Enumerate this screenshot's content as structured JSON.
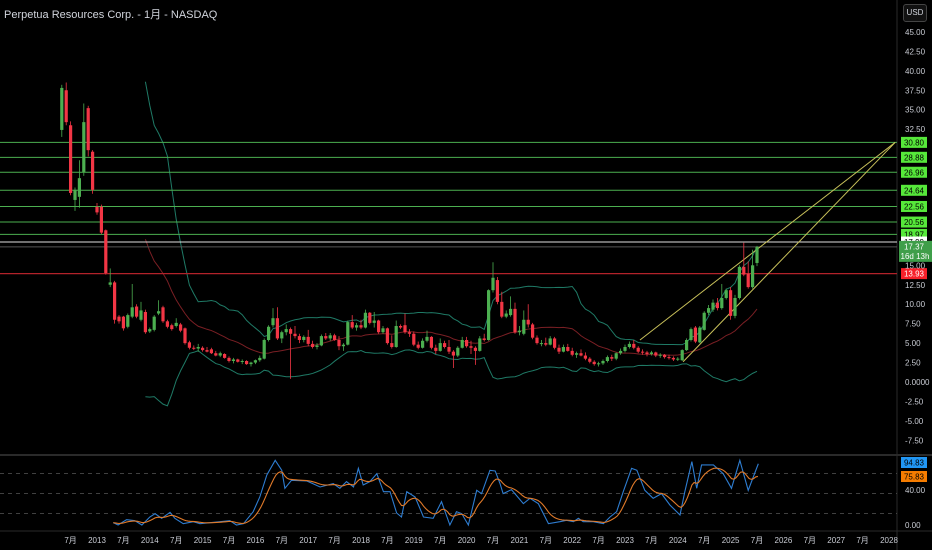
{
  "header": {
    "title": "Perpetua Resources Corp. - 1月 - NASDAQ",
    "currency_button": "USD"
  },
  "price_axis": {
    "ticks": [
      "45.00",
      "42.50",
      "40.00",
      "37.50",
      "35.00",
      "32.50",
      "15.00",
      "12.50",
      "10.00",
      "7.50",
      "5.00",
      "2.50",
      "0.0000",
      "-2.50",
      "-5.00",
      "-7.50"
    ],
    "tick_values": [
      45,
      42.5,
      40,
      37.5,
      35,
      32.5,
      15,
      12.5,
      10,
      7.5,
      5,
      2.5,
      0,
      -2.5,
      -5,
      -7.5
    ]
  },
  "levels": [
    {
      "value": 30.8,
      "label": "30.80",
      "kind": "green"
    },
    {
      "value": 28.88,
      "label": "28.88",
      "kind": "green"
    },
    {
      "value": 26.96,
      "label": "26.96",
      "kind": "green"
    },
    {
      "value": 24.64,
      "label": "24.64",
      "kind": "green"
    },
    {
      "value": 22.56,
      "label": "22.56",
      "kind": "green"
    },
    {
      "value": 20.56,
      "label": "20.56",
      "kind": "green"
    },
    {
      "value": 18.97,
      "label": "18.97",
      "kind": "green"
    },
    {
      "value": 17.99,
      "label": "17.99",
      "kind": "white"
    },
    {
      "value": 13.93,
      "label": "13.93",
      "kind": "red"
    }
  ],
  "current_price": {
    "value": 17.37,
    "label": "17.37",
    "countdown": "16d 13h"
  },
  "colors": {
    "up": "#4caf50",
    "down": "#f23645",
    "level_green": "#4caf50",
    "level_tag": "#56e83a",
    "red_level": "#b2222a",
    "red_tag": "#f7202a",
    "band": "#1f7a66",
    "basis": "#7a1f24",
    "trend": "#c8c05a",
    "rsi_k": "#2e7dd1",
    "rsi_d": "#e07a2a"
  },
  "rsi": {
    "k_label": "94.83",
    "d_label": "75.83",
    "ticks": [
      "40.00",
      "0.00"
    ],
    "tick_values": [
      40,
      0
    ],
    "bands": [
      80,
      50,
      20
    ]
  },
  "time_axis": [
    {
      "label": "7月",
      "m": -6
    },
    {
      "label": "2013",
      "m": 0
    },
    {
      "label": "7月",
      "m": 6
    },
    {
      "label": "2014",
      "m": 12
    },
    {
      "label": "7月",
      "m": 18
    },
    {
      "label": "2015",
      "m": 24
    },
    {
      "label": "7月",
      "m": 30
    },
    {
      "label": "2016",
      "m": 36
    },
    {
      "label": "7月",
      "m": 42
    },
    {
      "label": "2017",
      "m": 48
    },
    {
      "label": "7月",
      "m": 54
    },
    {
      "label": "2018",
      "m": 60
    },
    {
      "label": "7月",
      "m": 66
    },
    {
      "label": "2019",
      "m": 72
    },
    {
      "label": "7月",
      "m": 78
    },
    {
      "label": "2020",
      "m": 84
    },
    {
      "label": "7月",
      "m": 90
    },
    {
      "label": "2021",
      "m": 96
    },
    {
      "label": "7月",
      "m": 102
    },
    {
      "label": "2022",
      "m": 108
    },
    {
      "label": "7月",
      "m": 114
    },
    {
      "label": "2023",
      "m": 120
    },
    {
      "label": "7月",
      "m": 126
    },
    {
      "label": "2024",
      "m": 132
    },
    {
      "label": "7月",
      "m": 138
    },
    {
      "label": "2025",
      "m": 144
    },
    {
      "label": "7月",
      "m": 150
    },
    {
      "label": "2026",
      "m": 156
    },
    {
      "label": "7月",
      "m": 162
    },
    {
      "label": "2027",
      "m": 168
    },
    {
      "label": "7月",
      "m": 174
    },
    {
      "label": "2028",
      "m": 180
    }
  ],
  "chart_data": {
    "type": "candlestick",
    "interval": "1M",
    "start_month_index": -8,
    "month_index_note": "0 = Jan 2013",
    "ylim": [
      -8.5,
      48
    ],
    "candles_ohlc": [
      [
        32.4,
        38.2,
        31.5,
        37.8
      ],
      [
        37.5,
        38.5,
        33,
        33.4
      ],
      [
        33,
        33.5,
        24,
        24.3
      ],
      [
        23.4,
        25,
        22,
        24.7
      ],
      [
        23.8,
        28.5,
        22.4,
        26.2
      ],
      [
        27,
        35.8,
        26.5,
        33.4
      ],
      [
        35.2,
        35.5,
        29,
        29.8
      ],
      [
        29.6,
        29.8,
        24.2,
        24.7
      ],
      [
        22.5,
        23,
        21.5,
        21.8
      ],
      [
        22.5,
        22.8,
        19,
        19.2
      ],
      [
        19.5,
        19.6,
        13.8,
        14
      ],
      [
        12.5,
        14.6,
        12.2,
        12.8
      ],
      [
        12.8,
        13,
        7.5,
        8.0
      ],
      [
        8.4,
        8.6,
        7.5,
        7.8
      ],
      [
        8.4,
        8.5,
        6.6,
        6.9
      ],
      [
        7.1,
        8.8,
        6.9,
        8.6
      ],
      [
        8.4,
        12.6,
        8.2,
        9.6
      ],
      [
        9.7,
        10,
        8.2,
        8.4
      ],
      [
        8.0,
        10.3,
        7.8,
        9.2
      ],
      [
        9.0,
        9.3,
        6.2,
        6.4
      ],
      [
        6.5,
        7,
        6.3,
        6.8
      ],
      [
        6.7,
        8.6,
        6.5,
        8.4
      ],
      [
        8.8,
        10.5,
        8.6,
        9.1
      ],
      [
        9.6,
        9.8,
        7.6,
        7.8
      ],
      [
        7.8,
        8,
        6.9,
        7.1
      ],
      [
        7.3,
        7.5,
        6.6,
        6.8
      ],
      [
        7.2,
        8.2,
        7,
        7.6
      ],
      [
        7.4,
        7.6,
        6.4,
        6.6
      ],
      [
        6.9,
        7,
        4.8,
        5.0
      ],
      [
        5.1,
        5.3,
        4.2,
        4.4
      ],
      [
        4.4,
        4.7,
        4.1,
        4.3
      ],
      [
        4.3,
        4.9,
        3.9,
        4.5
      ],
      [
        4.4,
        4.6,
        3.9,
        4.1
      ],
      [
        4.1,
        4.5,
        3.8,
        3.9
      ],
      [
        4.2,
        4.4,
        3.6,
        3.7
      ],
      [
        3.7,
        4,
        3.3,
        3.4
      ],
      [
        3.4,
        3.9,
        3.2,
        3.7
      ],
      [
        3.6,
        3.7,
        3.0,
        3.1
      ],
      [
        3.1,
        3.3,
        2.5,
        2.7
      ],
      [
        2.7,
        3.1,
        2.4,
        2.9
      ],
      [
        2.9,
        3.0,
        2.5,
        2.6
      ],
      [
        2.6,
        2.9,
        2.3,
        2.7
      ],
      [
        2.7,
        2.8,
        2.2,
        2.3
      ],
      [
        2.3,
        2.6,
        2.0,
        2.5
      ],
      [
        2.5,
        2.9,
        2.3,
        2.8
      ],
      [
        2.8,
        3.4,
        2.6,
        3.1
      ],
      [
        3.0,
        5.6,
        2.9,
        5.4
      ],
      [
        5.4,
        7.3,
        5.2,
        7.1
      ],
      [
        7.3,
        9.5,
        7.0,
        8.2
      ],
      [
        8.2,
        9.6,
        5.4,
        5.6
      ],
      [
        5.6,
        6.6,
        5.0,
        6.4
      ],
      [
        6.4,
        7.4,
        6.0,
        6.8
      ],
      [
        6.8,
        7.0,
        0.4,
        6.2
      ],
      [
        6.2,
        7.2,
        5.6,
        5.9
      ],
      [
        5.9,
        6.2,
        5.0,
        5.4
      ],
      [
        5.4,
        6.0,
        5.1,
        5.8
      ],
      [
        5.8,
        6.7,
        4.6,
        4.9
      ],
      [
        4.9,
        5.3,
        4.3,
        4.5
      ],
      [
        4.5,
        5.0,
        4.2,
        4.7
      ],
      [
        4.7,
        6.1,
        4.6,
        5.9
      ],
      [
        5.9,
        6.3,
        5.4,
        5.6
      ],
      [
        5.6,
        6.3,
        5.3,
        6.0
      ],
      [
        6.0,
        6.2,
        5.3,
        5.4
      ],
      [
        5.4,
        5.9,
        4.1,
        4.6
      ],
      [
        4.6,
        5.0,
        4.0,
        4.8
      ],
      [
        4.8,
        7.9,
        4.7,
        7.7
      ],
      [
        7.7,
        8.6,
        6.8,
        7.0
      ],
      [
        7.0,
        7.6,
        6.6,
        7.3
      ],
      [
        7.3,
        8.0,
        6.8,
        7.0
      ],
      [
        7.0,
        9.3,
        6.9,
        8.9
      ],
      [
        8.9,
        9.0,
        7.4,
        7.6
      ],
      [
        7.6,
        9.0,
        7.0,
        7.9
      ],
      [
        7.9,
        8.0,
        6.2,
        6.4
      ],
      [
        6.4,
        7.2,
        6.2,
        6.9
      ],
      [
        6.9,
        7.0,
        4.8,
        5.0
      ],
      [
        5.0,
        6.0,
        4.3,
        4.5
      ],
      [
        4.5,
        7.9,
        4.4,
        7.2
      ],
      [
        7.2,
        7.4,
        6.8,
        7.0
      ],
      [
        7.3,
        8.8,
        6.2,
        6.4
      ],
      [
        6.4,
        6.8,
        5.8,
        6.2
      ],
      [
        6.2,
        6.5,
        4.6,
        4.8
      ],
      [
        4.8,
        5.2,
        4.2,
        4.4
      ],
      [
        4.4,
        5.6,
        4.3,
        5.3
      ],
      [
        5.3,
        6.6,
        5.1,
        5.8
      ],
      [
        5.8,
        5.9,
        4.2,
        4.4
      ],
      [
        4.4,
        4.8,
        3.6,
        4.0
      ],
      [
        4.0,
        5.6,
        3.9,
        5.0
      ],
      [
        5.0,
        5.3,
        4.3,
        4.5
      ],
      [
        4.5,
        5.4,
        3.6,
        3.9
      ],
      [
        3.9,
        4.1,
        1.8,
        3.4
      ],
      [
        3.4,
        4.6,
        3.2,
        4.4
      ],
      [
        4.4,
        5.8,
        4.3,
        5.4
      ],
      [
        5.4,
        5.8,
        4.4,
        4.6
      ],
      [
        4.6,
        5.3,
        3.6,
        4.4
      ],
      [
        4.4,
        4.6,
        2.2,
        4.0
      ],
      [
        4.0,
        5.9,
        3.9,
        5.6
      ],
      [
        5.6,
        6.2,
        5.2,
        5.4
      ],
      [
        5.4,
        11.9,
        5.3,
        11.8
      ],
      [
        11.8,
        15.4,
        11.5,
        13.4
      ],
      [
        13.1,
        13.5,
        10.0,
        10.3
      ],
      [
        10.3,
        11.6,
        8.2,
        8.4
      ],
      [
        8.4,
        9.2,
        8.2,
        8.8
      ],
      [
        8.6,
        11.0,
        8.4,
        9.4
      ],
      [
        9.4,
        10.2,
        6.2,
        6.4
      ],
      [
        6.4,
        7.2,
        6.0,
        6.6
      ],
      [
        6.2,
        9.2,
        6.0,
        8.0
      ],
      [
        8.0,
        10.0,
        7.0,
        7.4
      ],
      [
        7.4,
        7.6,
        5.5,
        5.7
      ],
      [
        5.7,
        6.0,
        4.8,
        5.0
      ],
      [
        5.0,
        5.4,
        4.6,
        5.0
      ],
      [
        5.0,
        5.7,
        4.6,
        4.8
      ],
      [
        4.8,
        5.9,
        4.7,
        5.6
      ],
      [
        5.6,
        5.8,
        4.2,
        4.4
      ],
      [
        4.4,
        4.8,
        3.6,
        3.9
      ],
      [
        3.9,
        4.8,
        3.8,
        4.5
      ],
      [
        4.5,
        4.9,
        3.9,
        4.0
      ],
      [
        4.0,
        4.4,
        3.3,
        3.5
      ],
      [
        3.5,
        3.9,
        3.1,
        3.7
      ],
      [
        3.7,
        4.2,
        3.3,
        3.4
      ],
      [
        3.4,
        3.8,
        2.8,
        3.0
      ],
      [
        3.0,
        3.2,
        2.4,
        2.6
      ],
      [
        2.6,
        2.8,
        2.1,
        2.3
      ],
      [
        2.3,
        2.6,
        2.0,
        2.4
      ],
      [
        2.4,
        2.9,
        2.2,
        2.7
      ],
      [
        2.7,
        3.4,
        2.5,
        3.2
      ],
      [
        3.2,
        3.5,
        2.7,
        3.0
      ],
      [
        3.0,
        3.8,
        2.8,
        3.7
      ],
      [
        3.7,
        4.3,
        3.5,
        4.0
      ],
      [
        4.0,
        4.8,
        3.8,
        4.5
      ],
      [
        4.5,
        5.2,
        4.3,
        4.9
      ],
      [
        4.9,
        5.4,
        4.2,
        4.4
      ],
      [
        4.4,
        4.6,
        3.7,
        3.9
      ],
      [
        3.9,
        4.2,
        3.5,
        3.8
      ],
      [
        3.8,
        4.0,
        3.3,
        3.6
      ],
      [
        3.6,
        4.0,
        3.4,
        3.8
      ],
      [
        3.8,
        3.9,
        3.2,
        3.4
      ],
      [
        3.4,
        3.7,
        3.1,
        3.5
      ],
      [
        3.5,
        3.6,
        3.0,
        3.2
      ],
      [
        3.2,
        3.5,
        2.9,
        3.1
      ],
      [
        3.1,
        3.3,
        2.7,
        2.9
      ],
      [
        2.9,
        3.2,
        2.7,
        3.0
      ],
      [
        2.8,
        4.2,
        2.7,
        4.1
      ],
      [
        4.1,
        5.6,
        4.0,
        5.4
      ],
      [
        5.4,
        7.0,
        5.2,
        6.8
      ],
      [
        7.0,
        7.2,
        5.0,
        5.2
      ],
      [
        5.1,
        7.2,
        5.0,
        7.0
      ],
      [
        6.7,
        9.1,
        6.6,
        8.9
      ],
      [
        8.9,
        9.9,
        8.6,
        9.5
      ],
      [
        9.3,
        10.6,
        9.0,
        10.2
      ],
      [
        10.2,
        10.8,
        9.2,
        9.5
      ],
      [
        9.5,
        12.6,
        9.3,
        10.8
      ],
      [
        10.8,
        12.0,
        10.6,
        11.8
      ],
      [
        11.8,
        12.2,
        8.0,
        8.5
      ],
      [
        8.5,
        11.2,
        8.2,
        10.8
      ],
      [
        10.8,
        15.0,
        10.6,
        14.8
      ],
      [
        14.8,
        17.9,
        13.6,
        13.8
      ],
      [
        13.9,
        15.5,
        12.0,
        12.2
      ],
      [
        12.2,
        17.0,
        12.0,
        15.0
      ],
      [
        15.3,
        17.5,
        14.9,
        17.37
      ]
    ],
    "bollinger": {
      "period": 20,
      "mult": 2
    },
    "trendlines": [
      {
        "from": [
          123.4,
          5.4
        ],
        "to": [
          181.4,
          30.8
        ]
      },
      {
        "from": [
          133.2,
          2.6
        ],
        "to": [
          181.4,
          30.8
        ]
      }
    ],
    "rsi_k_points": [
      [
        3.7,
        6.5
      ],
      [
        4.8,
        3
      ],
      [
        6.7,
        11
      ],
      [
        8.6,
        9.5
      ],
      [
        10.2,
        3
      ],
      [
        12,
        15
      ],
      [
        13.2,
        20
      ],
      [
        14.7,
        13
      ],
      [
        16.6,
        22
      ],
      [
        17.7,
        13
      ],
      [
        19.6,
        5
      ],
      [
        21.9,
        8
      ],
      [
        23.4,
        5
      ],
      [
        25.7,
        6.5
      ],
      [
        28,
        8
      ],
      [
        30.2,
        9.5
      ],
      [
        31.7,
        3
      ],
      [
        33.3,
        5
      ],
      [
        35.5,
        23
      ],
      [
        37,
        45
      ],
      [
        38.6,
        78
      ],
      [
        40.5,
        100
      ],
      [
        42,
        85
      ],
      [
        42.7,
        58
      ],
      [
        44.2,
        70
      ],
      [
        47.7,
        69
      ],
      [
        50.7,
        60
      ],
      [
        53.7,
        65
      ],
      [
        55.2,
        58
      ],
      [
        56.7,
        68
      ],
      [
        58.3,
        60
      ],
      [
        59.4,
        88
      ],
      [
        60.5,
        63
      ],
      [
        62,
        68
      ],
      [
        63.6,
        80
      ],
      [
        65.1,
        53
      ],
      [
        66.6,
        53
      ],
      [
        68.1,
        21
      ],
      [
        69.2,
        15
      ],
      [
        70.4,
        53
      ],
      [
        72.3,
        45
      ],
      [
        74.2,
        15
      ],
      [
        76.4,
        13
      ],
      [
        78.3,
        38
      ],
      [
        80.2,
        3
      ],
      [
        81.7,
        23
      ],
      [
        82.9,
        20
      ],
      [
        84.4,
        3
      ],
      [
        86.3,
        55
      ],
      [
        87.4,
        50
      ],
      [
        89.3,
        85
      ],
      [
        90.5,
        84
      ],
      [
        91.6,
        65
      ],
      [
        92.3,
        50
      ],
      [
        94.2,
        56
      ],
      [
        96.9,
        35
      ],
      [
        98.4,
        43
      ],
      [
        100.3,
        35
      ],
      [
        102.6,
        5
      ],
      [
        105.2,
        8
      ],
      [
        106.7,
        10
      ],
      [
        108.3,
        8
      ],
      [
        109.4,
        13
      ],
      [
        110.5,
        8
      ],
      [
        112.8,
        8
      ],
      [
        115.1,
        5
      ],
      [
        116.6,
        15
      ],
      [
        118.1,
        23
      ],
      [
        119.6,
        53
      ],
      [
        121.5,
        88
      ],
      [
        122.7,
        85
      ],
      [
        124.5,
        55
      ],
      [
        126.4,
        43
      ],
      [
        128.3,
        50
      ],
      [
        130.2,
        33
      ],
      [
        132.5,
        18
      ],
      [
        133.6,
        53
      ],
      [
        135.2,
        98
      ],
      [
        136.3,
        58
      ],
      [
        137.4,
        93
      ],
      [
        140.1,
        93
      ],
      [
        142.3,
        80
      ],
      [
        144.2,
        58
      ],
      [
        146.1,
        100
      ],
      [
        148,
        55
      ],
      [
        150.3,
        94.83
      ]
    ],
    "rsi_k_last": 94.83,
    "rsi_d_last": 75.83,
    "rsi_ylim": [
      0,
      100
    ]
  }
}
